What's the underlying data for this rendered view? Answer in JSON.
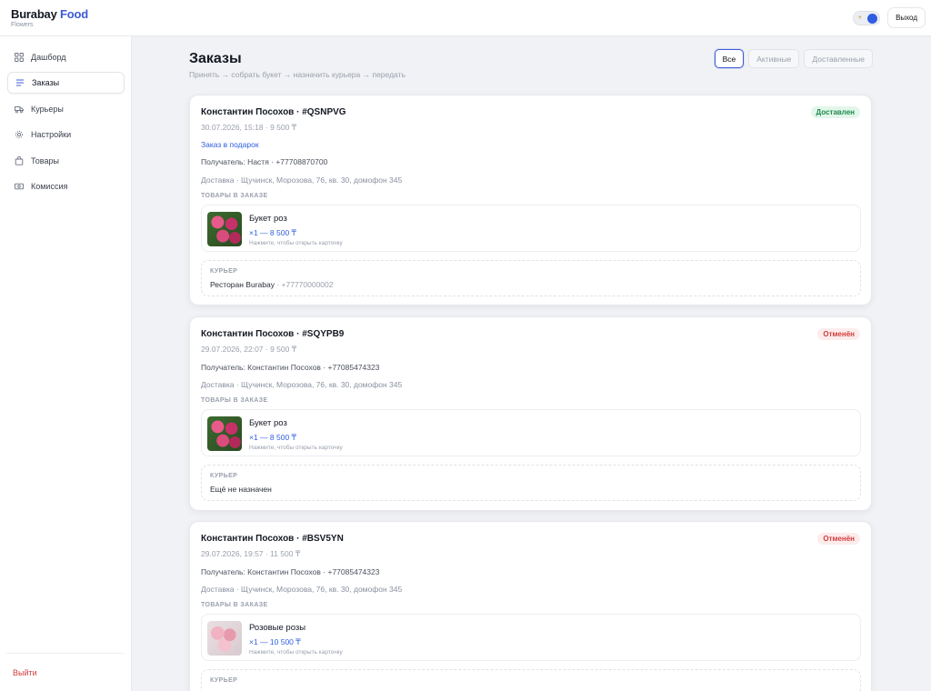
{
  "brand": {
    "name_part1": "Burabay",
    "name_part2": "Food",
    "subtitle": "Flowers"
  },
  "topbar": {
    "theme_toggle": "on",
    "logout_label": "Выход"
  },
  "sidebar": {
    "items": [
      {
        "label": "Дашборд",
        "icon": "dashboard-icon"
      },
      {
        "label": "Заказы",
        "icon": "list-icon",
        "active": true
      },
      {
        "label": "Курьеры",
        "icon": "truck-icon"
      },
      {
        "label": "Настройки",
        "icon": "gear-icon"
      },
      {
        "label": "Товары",
        "icon": "bag-icon"
      },
      {
        "label": "Комиссия",
        "icon": "cash-icon"
      }
    ],
    "exit_label": "Выйти"
  },
  "page": {
    "title": "Заказы",
    "subtitle": "Принять → собрать букет → назначить курьера → передать",
    "filters": [
      "Все",
      "Активные",
      "Доставленные"
    ],
    "active_filter": "Все"
  },
  "colors": {
    "accent": "#3b5bd6",
    "success": "#1f8a4c",
    "danger": "#d23b3b"
  },
  "orders": [
    {
      "title": "Константин Посохов · #QSNPVG",
      "meta": "30.07.2026, 15:18 · 9 500 ₸",
      "status": "Доставлен",
      "gift": "Заказ в подарок",
      "recipient": "Получатель: Настя · +77708870700",
      "delivery": "Доставка · Щучинск, Морозова, 76, кв. 30, домофон 345",
      "items_label": "ТОВАРЫ В ЗАКАЗЕ",
      "item": {
        "name": "Букет роз",
        "price": "×1 — 8 500 ₸",
        "hint": "Нажмите, чтобы открыть карточку"
      },
      "courier_label": "КУРЬЕР",
      "courier_name": "Ресторан Burabay",
      "courier_phone": " · +77770000002"
    },
    {
      "title": "Константин Посохов · #SQYPB9",
      "meta": "29.07.2026, 22:07 · 9 500 ₸",
      "status": "Отменён",
      "recipient": "Получатель: Константин Посохов · +77085474323",
      "delivery": "Доставка · Щучинск, Морозова, 76, кв. 30, домофон 345",
      "items_label": "ТОВАРЫ В ЗАКАЗЕ",
      "item": {
        "name": "Букет роз",
        "price": "×1 — 8 500 ₸",
        "hint": "Нажмите, чтобы открыть карточку"
      },
      "courier_label": "КУРЬЕР",
      "courier_name": "Ещё не назначен"
    },
    {
      "title": "Константин Посохов · #BSV5YN",
      "meta": "29.07.2026, 19:57 · 11 500 ₸",
      "status": "Отменён",
      "recipient": "Получатель: Константин Посохов · +77085474323",
      "delivery": "Доставка · Щучинск, Морозова, 76, кв. 30, домофон 345",
      "items_label": "ТОВАРЫ В ЗАКАЗЕ",
      "item": {
        "name": "Розовые розы",
        "price": "×1 — 10 500 ₸",
        "hint": "Нажмите, чтобы открыть карточку"
      },
      "courier_label": "КУРЬЕР"
    }
  ]
}
